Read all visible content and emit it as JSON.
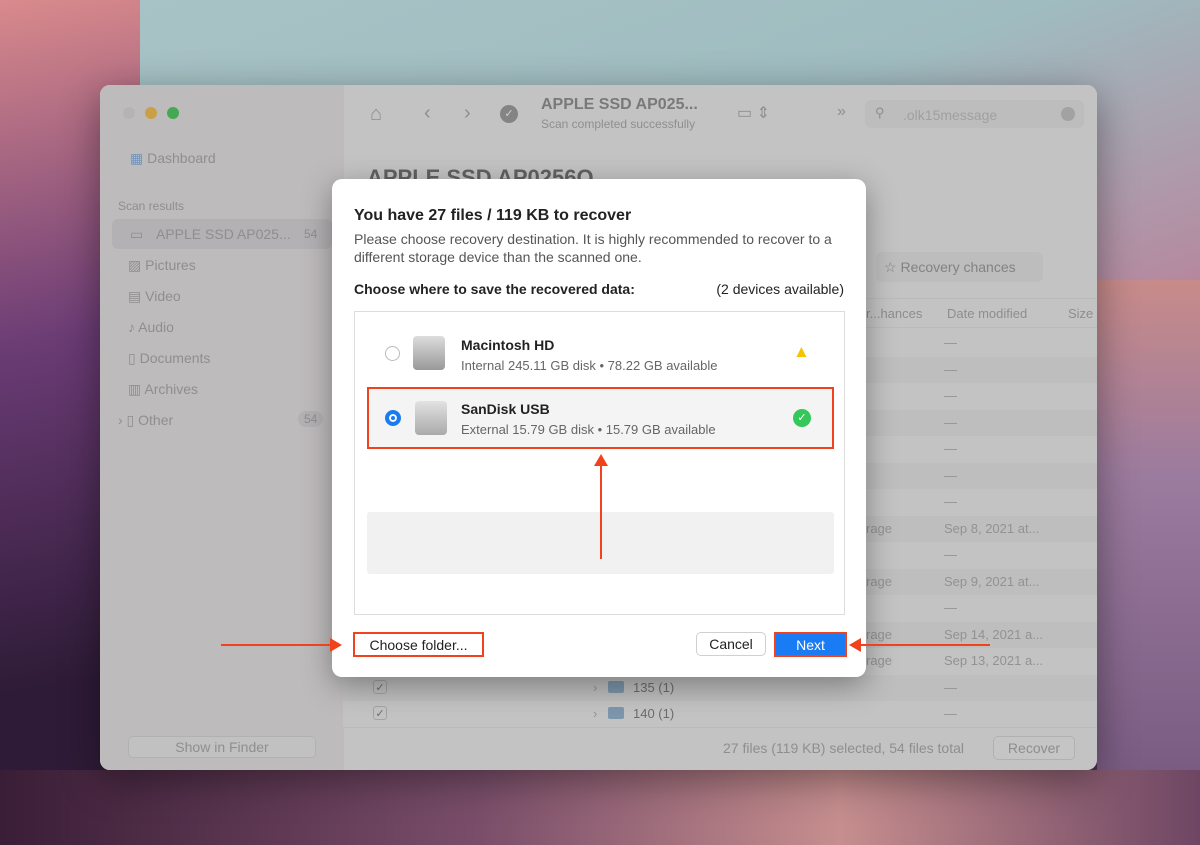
{
  "window": {
    "title": "APPLE SSD AP025...",
    "subtitle": "Scan completed successfully",
    "search_value": ".olk15message",
    "page_heading": "APPLE SSD AP0256Q",
    "recovery_chances_button": "Recovery chances"
  },
  "sidebar": {
    "dashboard": "Dashboard",
    "section": "Scan results",
    "items": [
      {
        "label": "APPLE SSD AP025...",
        "count": "54"
      },
      {
        "label": "Pictures"
      },
      {
        "label": "Video"
      },
      {
        "label": "Audio"
      },
      {
        "label": "Documents"
      },
      {
        "label": "Archives"
      },
      {
        "label": "Other",
        "count": "54"
      }
    ],
    "show_in_finder": "Show in Finder"
  },
  "table": {
    "columns": [
      "r...hances",
      "Date modified",
      "Size"
    ],
    "rows": [
      {
        "chance": "",
        "date": "—"
      },
      {
        "chance": "",
        "date": "—"
      },
      {
        "chance": "",
        "date": "—"
      },
      {
        "chance": "",
        "date": "—"
      },
      {
        "chance": "",
        "date": "—"
      },
      {
        "chance": "",
        "date": "—"
      },
      {
        "chance": "",
        "date": "—"
      },
      {
        "chance": "rage",
        "date": "Sep 8, 2021 at..."
      },
      {
        "chance": "",
        "date": "—"
      },
      {
        "chance": "rage",
        "date": "Sep 9, 2021 at..."
      },
      {
        "chance": "",
        "date": "—"
      },
      {
        "chance": "rage",
        "date": "Sep 14, 2021 a..."
      },
      {
        "chance": "rage",
        "date": "Sep 13, 2021 a..."
      },
      {
        "chance": "",
        "date": "—",
        "folder": "135 (1)"
      },
      {
        "chance": "",
        "date": "—",
        "folder": "140 (1)"
      }
    ]
  },
  "footer": {
    "status": "27 files (119 KB) selected, 54 files total",
    "recover": "Recover"
  },
  "dialog": {
    "title": "You have 27 files / 119 KB to recover",
    "desc": "Please choose recovery destination. It is highly recommended to recover to a different storage device than the scanned one.",
    "choose_label": "Choose where to save the recovered data:",
    "devices_count": "(2 devices available)",
    "devices": [
      {
        "name": "Macintosh HD",
        "info": "Internal 245.11 GB disk • 78.22 GB available",
        "status": "warning",
        "selected": false
      },
      {
        "name": "SanDisk USB",
        "info": "External 15.79 GB disk • 15.79 GB available",
        "status": "ok",
        "selected": true
      }
    ],
    "choose_folder": "Choose folder...",
    "cancel": "Cancel",
    "next": "Next"
  },
  "colors": {
    "accent": "#1a7cf5",
    "highlight": "#f0421c",
    "ok": "#34c759",
    "warning": "#f5c400"
  }
}
